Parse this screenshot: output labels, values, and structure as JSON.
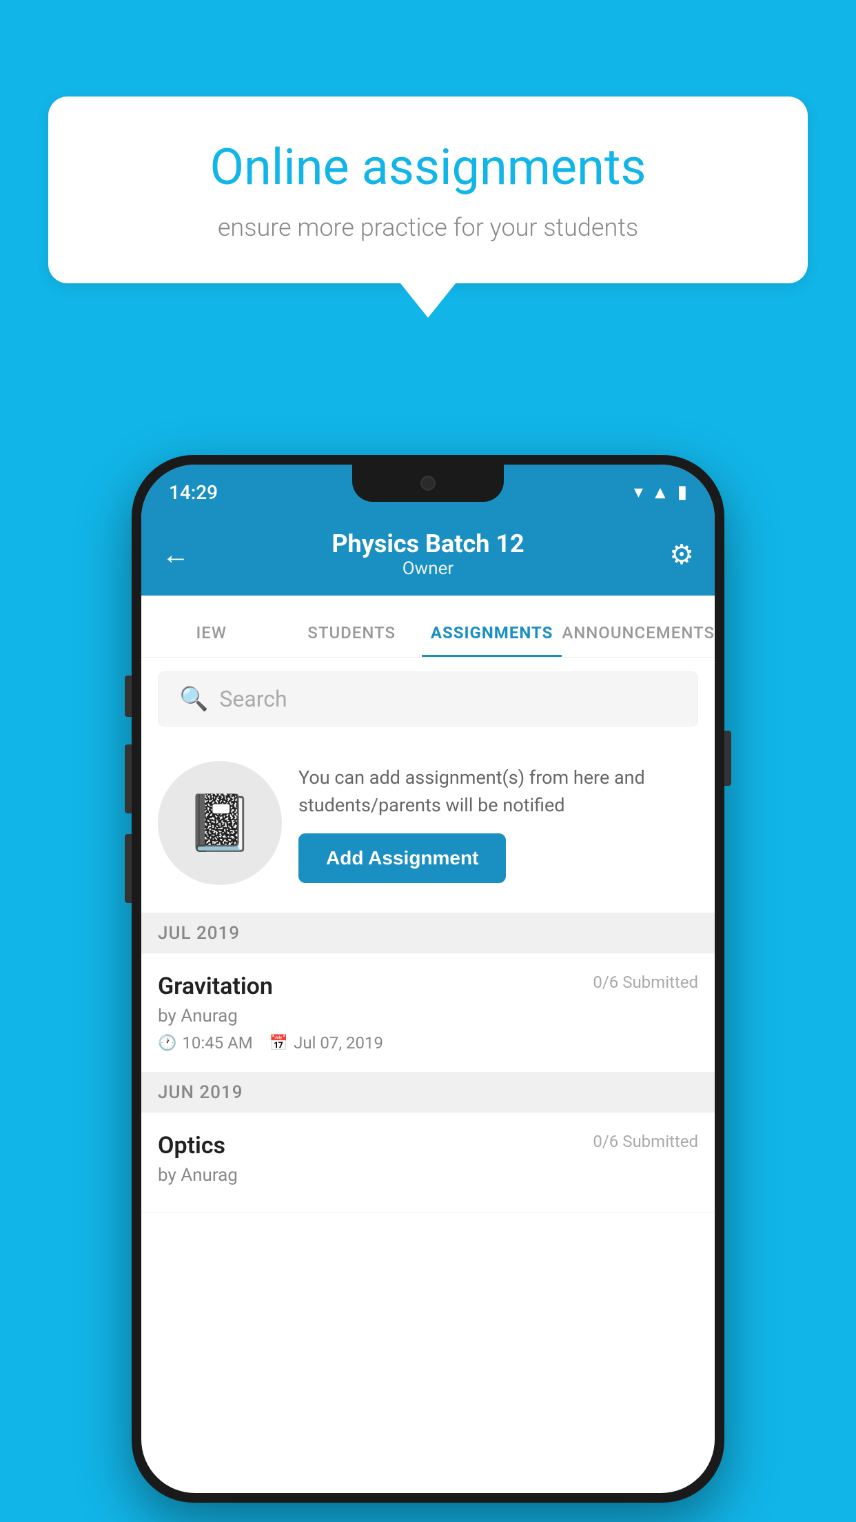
{
  "background": {
    "color": "#12B5E8"
  },
  "speech_bubble": {
    "title": "Online assignments",
    "subtitle": "ensure more practice for your students"
  },
  "phone": {
    "status_bar": {
      "time": "14:29"
    },
    "header": {
      "back_label": "←",
      "title": "Physics Batch 12",
      "subtitle": "Owner",
      "settings_icon": "⚙"
    },
    "tabs": [
      {
        "label": "IEW",
        "active": false
      },
      {
        "label": "STUDENTS",
        "active": false
      },
      {
        "label": "ASSIGNMENTS",
        "active": true
      },
      {
        "label": "ANNOUNCEMENTS",
        "active": false
      }
    ],
    "search": {
      "placeholder": "Search"
    },
    "promo": {
      "text": "You can add assignment(s) from here and students/parents will be notified",
      "button_label": "Add Assignment"
    },
    "assignments": {
      "sections": [
        {
          "month": "JUL 2019",
          "items": [
            {
              "name": "Gravitation",
              "submitted": "0/6 Submitted",
              "author": "by Anurag",
              "time": "10:45 AM",
              "date": "Jul 07, 2019"
            }
          ]
        },
        {
          "month": "JUN 2019",
          "items": [
            {
              "name": "Optics",
              "submitted": "0/6 Submitted",
              "author": "by Anurag",
              "time": "",
              "date": ""
            }
          ]
        }
      ]
    }
  }
}
